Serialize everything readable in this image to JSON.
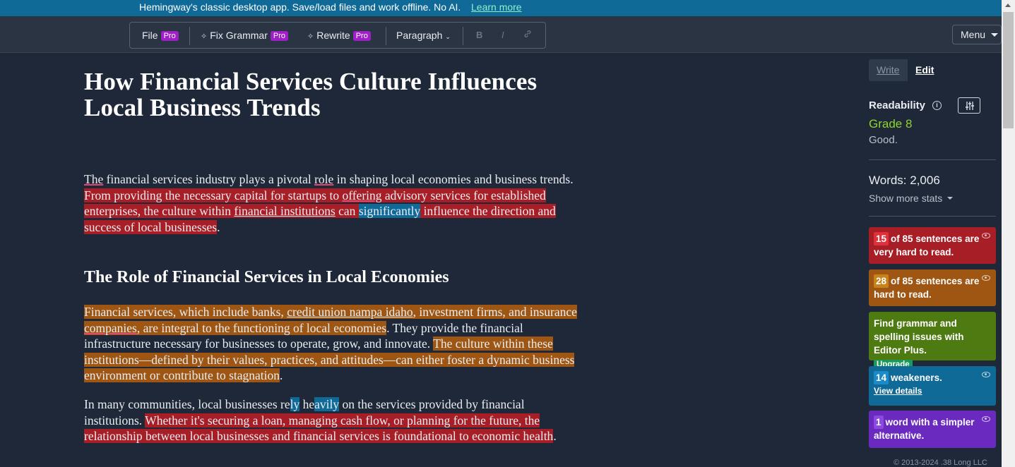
{
  "banner": {
    "message": "Hemingway's classic desktop app. Save/load files and work offline. No AI.",
    "link": "Learn more"
  },
  "toolbar": {
    "file": "File",
    "fix_grammar": "Fix Grammar",
    "rewrite": "Rewrite",
    "pro": "Pro",
    "paragraph": "Paragraph",
    "bold": "B",
    "italic": "I",
    "menu": "Menu"
  },
  "article": {
    "title": "How Financial Services Culture Influences Local Business Trends",
    "p1": {
      "s1a": "The",
      "s1b": " financial services industry plays a pivotal ",
      "s1c": "role",
      "s1d": " in shaping local economies and business trends. ",
      "s2a": "From providing the necessary capital for startups to ",
      "s2b": "offering",
      "s2c": " advisory services for established enterprises, the culture within ",
      "s2d": "financial institutions",
      "s2e": " can ",
      "s2f": "significantly",
      "s2g": " influence the direction and success of local businesses",
      "s2h": "."
    },
    "heading2": "The Role of Financial Services in Local Economies",
    "p2": {
      "a": "Financial services, which include banks, ",
      "b": "credit union nampa idaho",
      "c": ", investment firms, and insurance ",
      "d": "companies",
      "e": ", are integral to the functioning of local economies",
      "f": ". They provide the financial infrastructure necessary for businesses to operate, grow, and innovate. ",
      "g": "The culture within these institutions—defined by their values, practices, and attitudes—can either foster a dynamic business environment or contribute to stagnation",
      "h": "."
    },
    "p3": {
      "a": "In many communities, local businesses re",
      "b": "ly",
      "c": " he",
      "d": "avily",
      "e": " on the services provided by financial institutions. ",
      "f": "Whether it's securing a loan, managing cash flow, or planning for the future, the relationship between local businesses and financial services is foundational to economic health",
      "g": "."
    }
  },
  "sidebar": {
    "write": "Write",
    "edit": "Edit",
    "readability_label": "Readability",
    "grade": "Grade 8",
    "grade_desc": "Good.",
    "words": "Words: 2,006",
    "more_stats": "Show more stats",
    "cards": {
      "very_hard": {
        "num": "15",
        "text": "of 85 sentences are very hard to read."
      },
      "hard": {
        "num": "28",
        "text": "of 85 sentences are hard to read."
      },
      "grammar": {
        "text": "Find grammar and spelling issues with Editor Plus.",
        "button": "Upgrade"
      },
      "weakeners": {
        "num": "14",
        "text": "weakeners.",
        "link": "View details"
      },
      "simpler": {
        "num": "1",
        "text": "word with a simpler alternative."
      }
    },
    "footer": "© 2013-2024 .38 Long LLC"
  },
  "colors": {
    "very_hard": "#a81e26",
    "hard": "#9e5612",
    "adverb": "#0f6a98",
    "grammar": "#4e7a12",
    "simpler": "#6a2ac0",
    "grade": "#8fd42a"
  }
}
